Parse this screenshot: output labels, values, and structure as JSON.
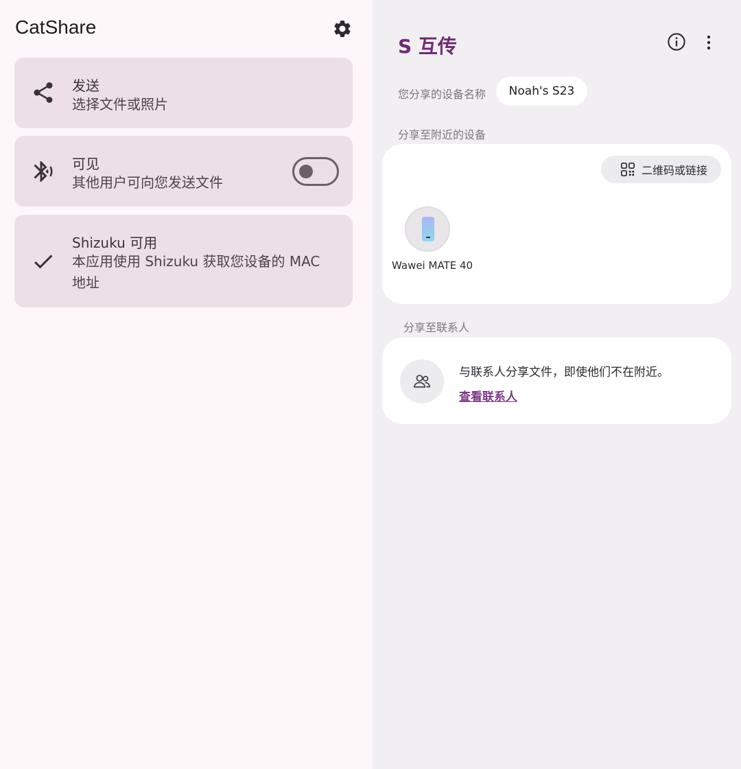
{
  "left": {
    "title": "CatShare",
    "cards": [
      {
        "title": "发送",
        "subtitle": "选择文件或照片"
      },
      {
        "title": "可见",
        "subtitle": "其他用户可向您发送文件",
        "toggle_on": false
      },
      {
        "title": "Shizuku 可用",
        "subtitle": "本应用使用 Shizuku 获取您设备的 MAC 地址"
      }
    ]
  },
  "right": {
    "title": "S 互传",
    "device_name_label": "您分享的设备名称",
    "device_name": "Noah's S23",
    "nearby_label": "分享至附近的设备",
    "qr_button": "二维码或链接",
    "nearby_devices": [
      {
        "name": "Wawei MATE 40"
      }
    ],
    "contacts_label": "分享至联系人",
    "contacts_text": "与联系人分享文件，即使他们不在附近。",
    "contacts_link": "查看联系人"
  },
  "colors": {
    "left_background": "#fdf7f9",
    "card_background": "#ecdfe6",
    "right_background": "#f1eff2",
    "accent": "#6f2b74"
  }
}
